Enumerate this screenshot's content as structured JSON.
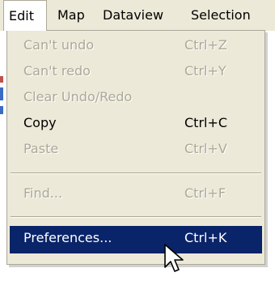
{
  "menubar": {
    "items": [
      {
        "label": "Edit"
      },
      {
        "label": "Map"
      },
      {
        "label": "Dataview"
      },
      {
        "label": "Selection"
      }
    ]
  },
  "edit_menu": {
    "items": [
      {
        "label": "Can't undo",
        "shortcut": "Ctrl+Z",
        "enabled": false
      },
      {
        "label": "Can't redo",
        "shortcut": "Ctrl+Y",
        "enabled": false
      },
      {
        "label": "Clear Undo/Redo",
        "shortcut": "",
        "enabled": false
      },
      {
        "label": "Copy",
        "shortcut": "Ctrl+C",
        "enabled": true
      },
      {
        "label": "Paste",
        "shortcut": "Ctrl+V",
        "enabled": false
      },
      {
        "label": "Find...",
        "shortcut": "Ctrl+F",
        "enabled": false
      },
      {
        "label": "Preferences...",
        "shortcut": "Ctrl+K",
        "enabled": true,
        "highlighted": true
      }
    ]
  },
  "colors": {
    "menu_background": "#ece9d8",
    "highlight": "#0a246a",
    "disabled_text": "#aca899"
  },
  "icons": {
    "cursor": "arrow-pointer-icon"
  }
}
